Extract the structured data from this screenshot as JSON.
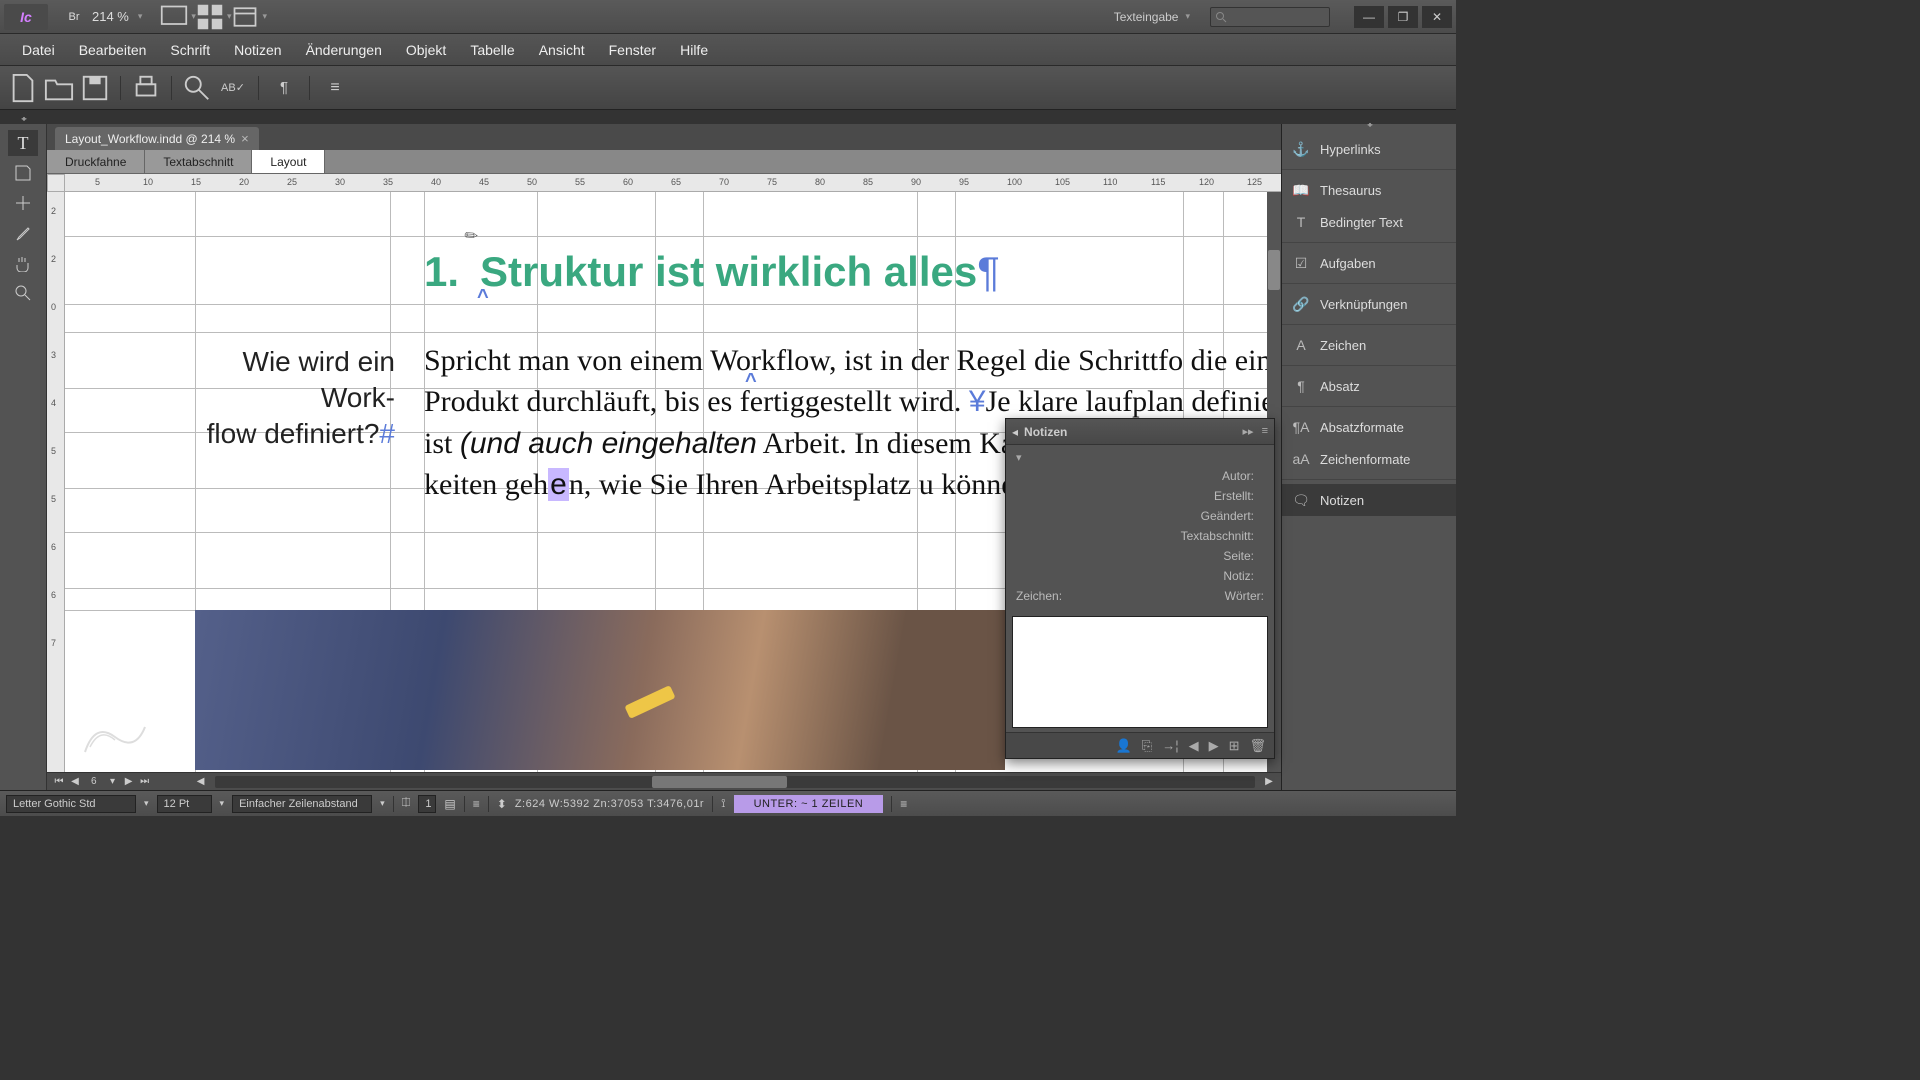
{
  "app": {
    "abbrev": "Ic"
  },
  "titlebar": {
    "zoom": "214 %",
    "mode": "Texteingabe"
  },
  "menus": [
    "Datei",
    "Bearbeiten",
    "Schrift",
    "Notizen",
    "Änderungen",
    "Objekt",
    "Tabelle",
    "Ansicht",
    "Fenster",
    "Hilfe"
  ],
  "document": {
    "tab": "Layout_Workflow.indd @ 214 %",
    "view_tabs": [
      "Druckfahne",
      "Textabschnitt",
      "Layout"
    ],
    "active_view": 2
  },
  "ruler_h": [
    5,
    10,
    15,
    20,
    25,
    30,
    35,
    40,
    45,
    50,
    55,
    60,
    65,
    70,
    75,
    80,
    85,
    90,
    95,
    100,
    105,
    110,
    115,
    120,
    125
  ],
  "ruler_v": [
    2,
    2,
    0,
    3,
    4,
    5,
    5,
    6,
    6,
    7
  ],
  "content": {
    "heading_num": "1.",
    "heading_text": "Struktur ist wirklich alles",
    "sidenote_l1": "Wie wird ein Work-",
    "sidenote_l2": "flow definiert?",
    "body": "Spricht man von einem Workflow, ist in der Regel die Schrittfo die ein Produkt durchläuft, bis es fertiggestellt wird. Je klare laufplan definiert ist (und auch eingehalten Arbeit. In diesem Kapitel soll es nun primä keiten gehen, wie Sie Ihren Arbeitsplatz u können.",
    "body_italic": "(und auch eingehalten"
  },
  "right_panels": [
    {
      "icon": "link",
      "label": "Hyperlinks"
    },
    {
      "icon": "book",
      "label": "Thesaurus"
    },
    {
      "icon": "cond",
      "label": "Bedingter Text"
    },
    {
      "icon": "task",
      "label": "Aufgaben"
    },
    {
      "icon": "chain",
      "label": "Verknüpfungen"
    },
    {
      "icon": "char",
      "label": "Zeichen"
    },
    {
      "icon": "para",
      "label": "Absatz"
    },
    {
      "icon": "pfmt",
      "label": "Absatzformate"
    },
    {
      "icon": "cfmt",
      "label": "Zeichenformate"
    },
    {
      "icon": "note",
      "label": "Notizen"
    }
  ],
  "notes_panel": {
    "title": "Notizen",
    "fields": {
      "autor": "Autor:",
      "erstellt": "Erstellt:",
      "geaendert": "Geändert:",
      "textabschnitt": "Textabschnitt:",
      "seite": "Seite:",
      "notiz": "Notiz:",
      "zeichen": "Zeichen:",
      "woerter": "Wörter:"
    }
  },
  "statusbar": {
    "font": "Letter Gothic Std",
    "size": "12 Pt",
    "leading": "Einfacher Zeilenabstand",
    "col": "1",
    "coords": "Z:624    W:5392    Zn:37053   T:3476,01r",
    "fit": "UNTER:  ~ 1 ZEILEN"
  },
  "pagebar": {
    "page": "6"
  }
}
